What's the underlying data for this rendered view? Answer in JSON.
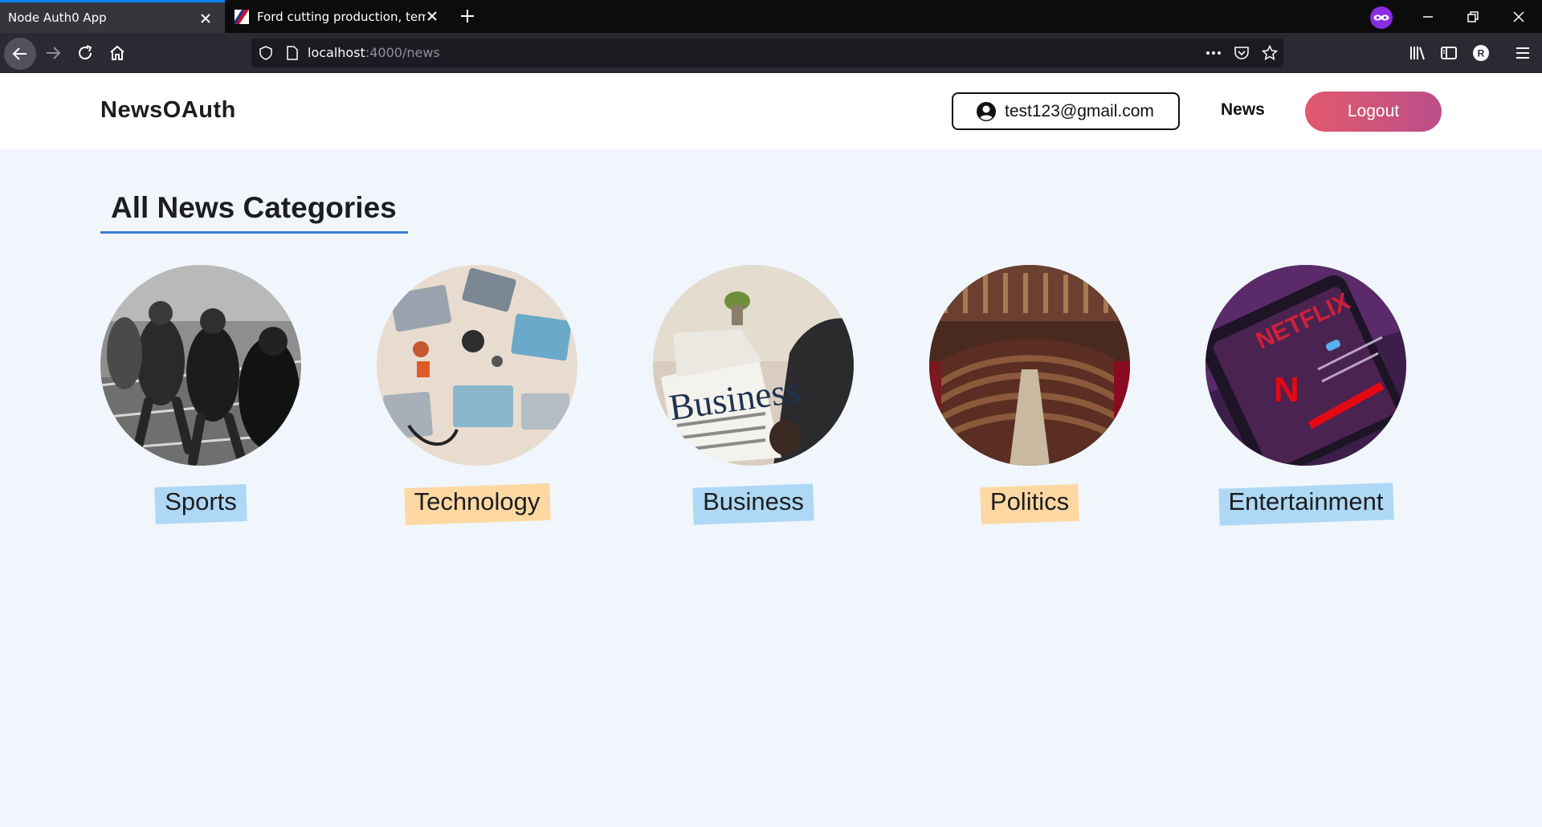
{
  "browser": {
    "tabs": [
      {
        "title": "Node Auth0 App",
        "active": true
      },
      {
        "title": "Ford cutting production, tempo",
        "active": false
      }
    ],
    "url": {
      "host": "localhost",
      "rest": ":4000/news"
    },
    "icons": [
      "back-arrow-icon",
      "forward-arrow-icon",
      "reload-icon",
      "home-icon",
      "shield-icon",
      "page-icon",
      "more-dots-icon",
      "pocket-icon",
      "bookmark-star-icon",
      "library-icon",
      "sidebar-icon",
      "account-icon",
      "menu-icon"
    ]
  },
  "header": {
    "brand": "NewsOAuth",
    "user_email": "test123@gmail.com",
    "nav_news": "News",
    "logout_label": "Logout",
    "colors": {
      "logout_start": "#e2596d",
      "logout_end": "#bb4f8a"
    }
  },
  "main": {
    "title": "All News Categories",
    "underline_color": "#3b7bd4",
    "categories": [
      {
        "label": "Sports",
        "highlight": "#aed8f5"
      },
      {
        "label": "Technology",
        "highlight": "#fdd8a3"
      },
      {
        "label": "Business",
        "highlight": "#aed8f5"
      },
      {
        "label": "Politics",
        "highlight": "#fdd8a3"
      },
      {
        "label": "Entertainment",
        "highlight": "#aed8f5"
      }
    ],
    "business_image_text": "Business",
    "netflix_image_text": "NETFLIX",
    "netflix_logo_letter": "N"
  }
}
